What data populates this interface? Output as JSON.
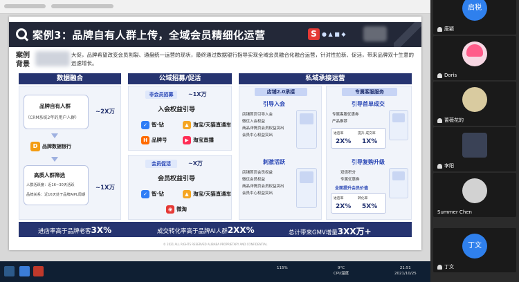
{
  "slide": {
    "title": "案例3：品牌自有人群上传，全域会员精细化运营",
    "background_label": "案例背景",
    "background_text": "大促，品牌希望改变会员割裂、通盘统一运营的现状，最终通过数据银行指导实现全域会员融合化融合运营，针对性拉新、促活，带来品牌双十生意的迅速增长。",
    "columns": {
      "data": "数据融合",
      "public": "公域招募/促活",
      "private": "私域承接运营"
    },
    "data_col": {
      "crowd_title": "品牌自有人群",
      "crowd_sub": "（CRM系统2年的用户人群）",
      "crowd_size": "~2X万",
      "bank_label": "品牌数据银行",
      "filter_title": "高质人群筛选",
      "filter_line1": "人群活跃度：近16~30天活跃",
      "filter_line2": "品牌关系：近16天处于品牌AIPL周期",
      "filter_size": "~1X万"
    },
    "public_col": {
      "nonmember_tag": "非会员招募",
      "nonmember_size": "~1X万",
      "nonmember_title": "入会权益引导",
      "nonmember_channels": [
        "智·钻",
        "淘宝/天猫直通车",
        "品牌号",
        "淘宝直播"
      ],
      "member_tag": "会员促活",
      "member_size": "~X万",
      "member_title": "会员权益引导",
      "member_channels": [
        "智·钻",
        "淘宝/天猫直通车",
        "微淘"
      ]
    },
    "private_col": {
      "store_head": "店铺2.0承接",
      "store_sec1": "引导入会",
      "store_list1": [
        "店铺首页引导入会",
        "微优入会权益",
        "商品详情页会员权益突出",
        "会员中心权益突出"
      ],
      "store_sec2": "刺激活跃",
      "store_list2": [
        "店铺首页会员权益",
        "微优会员权益",
        "商品详情页会员权益突出",
        "会员中心权益突出"
      ],
      "cs_head": "专属客服服务",
      "cs_sec1": "引导首单成交",
      "cs_list1": [
        "专属客服优惠券",
        "产品推荐"
      ],
      "cs_metric1_label_a": "进店率",
      "cs_metric1_label_b": "转化率",
      "cs_metric1_label_c": "提升-成交率",
      "cs_metric1_val_a": "2X%",
      "cs_metric1_val_b": "1X%",
      "cs_sec2": "引导复购升级",
      "cs_list2": [
        "双倍积分",
        "专属优惠券"
      ],
      "cs_highlight": "全面提升会员价值",
      "cs_metric2_val_a": "2X%",
      "cs_metric2_val_b": "5X%"
    },
    "bottom": {
      "left_text": "进店率高于品牌老客",
      "left_value": "3X%",
      "mid_text": "成交转化率高于品牌AI人群",
      "mid_value": "2XX%",
      "right_text": "总计带来GMV增量",
      "right_value": "3XX万+"
    },
    "footer": "© 2021 ALL RIGHTS RESERVED ALIBABA PROPRIETARY AND CONFIDENTIAL"
  },
  "taskbar": {
    "weather_temp": "9°C",
    "weather_label": "CPU温度",
    "time": "21:51",
    "date": "2021/10/25",
    "zoom": "115%"
  },
  "participants": [
    {
      "name": "唐颖",
      "avatar_text": "启税"
    },
    {
      "name": "Doris",
      "avatar_text": ""
    },
    {
      "name": "蔷薇花的",
      "avatar_text": ""
    },
    {
      "name": "李阳",
      "avatar_text": ""
    },
    {
      "name": "Summer Chen",
      "avatar_text": ""
    },
    {
      "name": "丁文",
      "avatar_text": "丁文"
    }
  ],
  "colors": {
    "navy": "#263470",
    "banner": "#232838",
    "accent_blue": "#2a47b5",
    "accent_red": "#e53935"
  }
}
